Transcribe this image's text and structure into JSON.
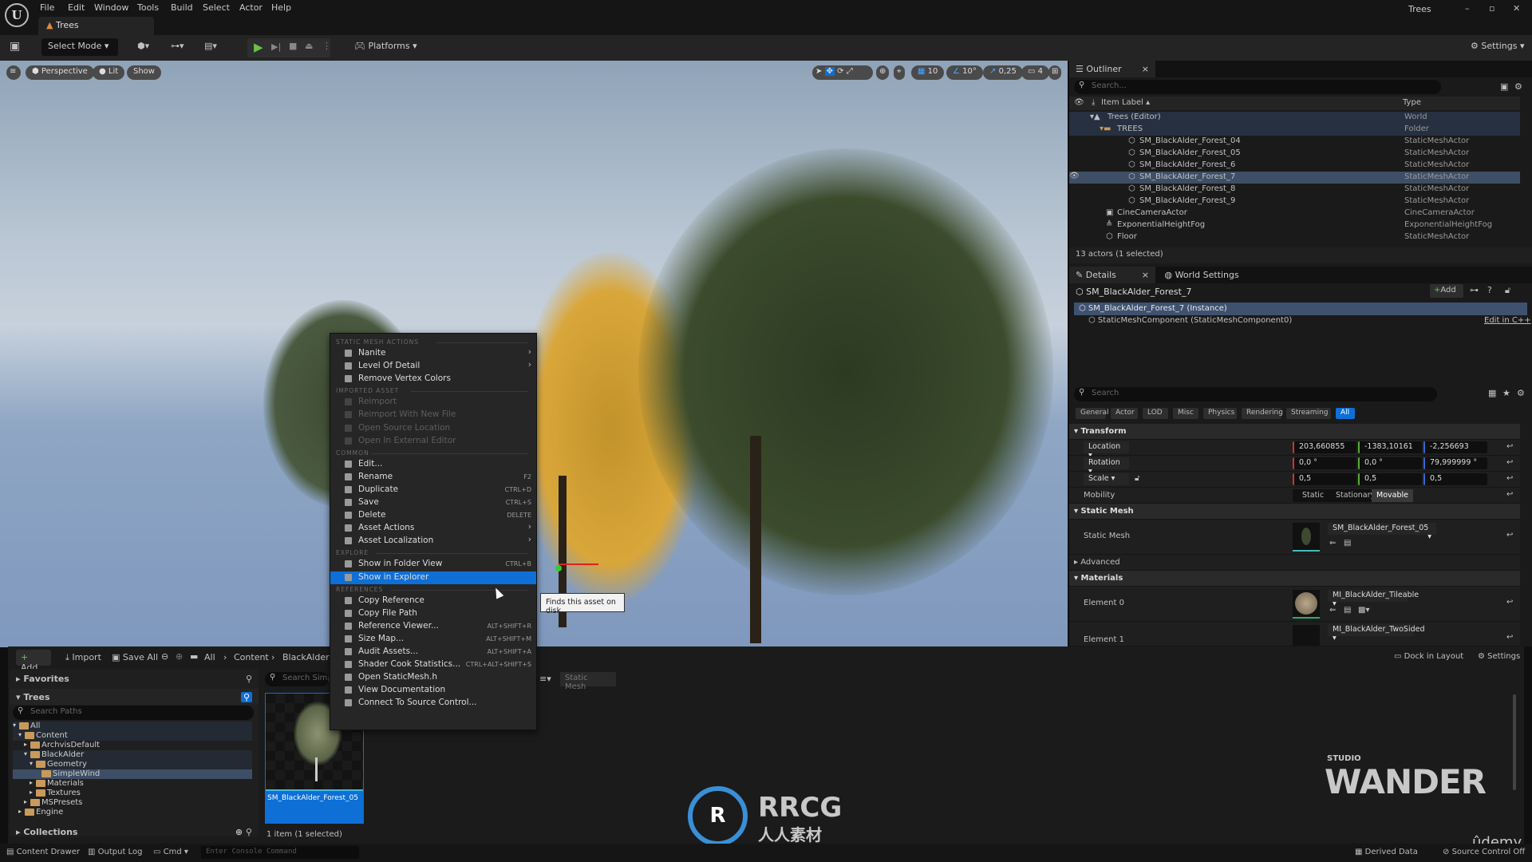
{
  "app": {
    "menu": [
      "File",
      "Edit",
      "Window",
      "Tools",
      "Build",
      "Select",
      "Actor",
      "Help"
    ],
    "doc_tab": "Trees",
    "project_name": "Trees",
    "window_controls": [
      "minimize",
      "maximize",
      "close"
    ]
  },
  "toolbar": {
    "select_mode": "Select Mode",
    "platforms": "Platforms",
    "settings": "Settings"
  },
  "viewport": {
    "perspective": "Perspective",
    "lit": "Lit",
    "show": "Show",
    "grid_snap": "10",
    "rotation_snap": "10°",
    "scale_snap": "0,25",
    "camera_speed": "4"
  },
  "context_menu": {
    "sections": [
      {
        "title": "STATIC MESH ACTIONS",
        "items": [
          {
            "label": "Nanite",
            "submenu": true
          },
          {
            "label": "Level Of Detail",
            "submenu": true
          },
          {
            "label": "Remove Vertex Colors"
          }
        ]
      },
      {
        "title": "IMPORTED ASSET",
        "items": [
          {
            "label": "Reimport",
            "disabled": true
          },
          {
            "label": "Reimport With New File",
            "disabled": true
          },
          {
            "label": "Open Source Location",
            "disabled": true
          },
          {
            "label": "Open In External Editor",
            "disabled": true
          }
        ]
      },
      {
        "title": "COMMON",
        "items": [
          {
            "label": "Edit..."
          },
          {
            "label": "Rename",
            "shortcut": "F2"
          },
          {
            "label": "Duplicate",
            "shortcut": "CTRL+D"
          },
          {
            "label": "Save",
            "shortcut": "CTRL+S"
          },
          {
            "label": "Delete",
            "shortcut": "DELETE"
          },
          {
            "label": "Asset Actions",
            "submenu": true
          },
          {
            "label": "Asset Localization",
            "submenu": true
          }
        ]
      },
      {
        "title": "EXPLORE",
        "items": [
          {
            "label": "Show in Folder View",
            "shortcut": "CTRL+B"
          },
          {
            "label": "Show in Explorer",
            "highlighted": true
          }
        ]
      },
      {
        "title": "REFERENCES",
        "items": [
          {
            "label": "Copy Reference"
          },
          {
            "label": "Copy File Path"
          },
          {
            "label": "Reference Viewer...",
            "shortcut": "ALT+SHIFT+R"
          },
          {
            "label": "Size Map...",
            "shortcut": "ALT+SHIFT+M"
          },
          {
            "label": "Audit Assets...",
            "shortcut": "ALT+SHIFT+A"
          },
          {
            "label": "Shader Cook Statistics...",
            "shortcut": "CTRL+ALT+SHIFT+S"
          },
          {
            "label": "Open StaticMesh.h"
          },
          {
            "label": "View Documentation"
          },
          {
            "label": "Connect To Source Control..."
          }
        ]
      }
    ],
    "tooltip": "Finds this asset on disk"
  },
  "outliner": {
    "tab": "Outliner",
    "search_placeholder": "Search...",
    "col_label": "Item Label",
    "col_type": "Type",
    "rows": [
      {
        "label": "Trees (Editor)",
        "type": "World",
        "depth": 0,
        "icon": "world-icon",
        "hl": true
      },
      {
        "label": "TREES",
        "type": "Folder",
        "depth": 1,
        "icon": "folder-icon",
        "hl": true
      },
      {
        "label": "SM_BlackAlder_Forest_04",
        "type": "StaticMeshActor",
        "depth": 2,
        "icon": "static-mesh-icon"
      },
      {
        "label": "SM_BlackAlder_Forest_05",
        "type": "StaticMeshActor",
        "depth": 2,
        "icon": "static-mesh-icon"
      },
      {
        "label": "SM_BlackAlder_Forest_6",
        "type": "StaticMeshActor",
        "depth": 2,
        "icon": "static-mesh-icon"
      },
      {
        "label": "SM_BlackAlder_Forest_7",
        "type": "StaticMeshActor",
        "depth": 2,
        "icon": "static-mesh-icon",
        "selected": true
      },
      {
        "label": "SM_BlackAlder_Forest_8",
        "type": "StaticMeshActor",
        "depth": 2,
        "icon": "static-mesh-icon"
      },
      {
        "label": "SM_BlackAlder_Forest_9",
        "type": "StaticMeshActor",
        "depth": 2,
        "icon": "static-mesh-icon"
      },
      {
        "label": "CineCameraActor",
        "type": "CineCameraActor",
        "depth": 1,
        "icon": "camera-icon"
      },
      {
        "label": "ExponentialHeightFog",
        "type": "ExponentialHeightFog",
        "depth": 1,
        "icon": "fog-icon"
      },
      {
        "label": "Floor",
        "type": "StaticMeshActor",
        "depth": 1,
        "icon": "static-mesh-icon"
      }
    ],
    "status": "13 actors (1 selected)"
  },
  "details": {
    "tab": "Details",
    "tab2": "World Settings",
    "actor_name": "SM_BlackAlder_Forest_7",
    "add": "Add",
    "instance": "SM_BlackAlder_Forest_7 (Instance)",
    "component": "StaticMeshComponent (StaticMeshComponent0)",
    "edit_cpp": "Edit in C++",
    "search_placeholder": "Search",
    "filters": [
      "General",
      "Actor",
      "LOD",
      "Misc",
      "Physics",
      "Rendering",
      "Streaming",
      "All"
    ],
    "transform": {
      "title": "Transform",
      "location_label": "Location",
      "location": [
        "203,660855",
        "-1383,10161",
        "-2,256693"
      ],
      "rotation_label": "Rotation",
      "rotation": [
        "0,0 °",
        "0,0 °",
        "79,999999 °"
      ],
      "scale_label": "Scale",
      "scale": [
        "0,5",
        "0,5",
        "0,5"
      ],
      "mobility_label": "Mobility",
      "mobility_options": [
        "Static",
        "Stationary",
        "Movable"
      ],
      "mobility_selected": "Movable"
    },
    "static_mesh": {
      "title": "Static Mesh",
      "label": "Static Mesh",
      "value": "SM_BlackAlder_Forest_05"
    },
    "advanced": "Advanced",
    "materials": {
      "title": "Materials",
      "elements": [
        {
          "label": "Element 0",
          "value": "MI_BlackAlder_Tileable"
        },
        {
          "label": "Element 1",
          "value": "MI_BlackAlder_TwoSided"
        }
      ]
    }
  },
  "content_browser": {
    "add": "Add",
    "import": "Import",
    "save_all": "Save All",
    "breadcrumb": [
      "All",
      "Content",
      "BlackAlder"
    ],
    "favorites": "Favorites",
    "tree_title": "Trees",
    "search_paths": "Search Paths",
    "search_assets": "Search SimpleWind",
    "filter_chip": "Static Mesh",
    "tree": [
      {
        "label": "All",
        "depth": 0
      },
      {
        "label": "Content",
        "depth": 1
      },
      {
        "label": "ArchvisDefault",
        "depth": 2
      },
      {
        "label": "BlackAlder",
        "depth": 2
      },
      {
        "label": "Geometry",
        "depth": 3
      },
      {
        "label": "SimpleWind",
        "depth": 4,
        "selected": true
      },
      {
        "label": "Materials",
        "depth": 3
      },
      {
        "label": "Textures",
        "depth": 3
      },
      {
        "label": "MSPresets",
        "depth": 2
      },
      {
        "label": "Engine",
        "depth": 1
      }
    ],
    "collections": "Collections",
    "asset": "SM_BlackAlder_Forest_05",
    "item_count": "1 item (1 selected)",
    "dock": "Dock in Layout",
    "settings": "Settings"
  },
  "statusbar": {
    "content_drawer": "Content Drawer",
    "output_log": "Output Log",
    "cmd": "Cmd",
    "console_placeholder": "Enter Console Command",
    "derived_data": "Derived Data",
    "source_control": "Source Control Off"
  },
  "watermarks": {
    "rrcg": "RRCG",
    "rrcg_sub": "人人素材",
    "studio": "STUDIO",
    "wander": "WANDER",
    "udemy": "ûdemy"
  },
  "colors": {
    "accent": "#0e6fd6",
    "selection": "#3e4e66"
  }
}
